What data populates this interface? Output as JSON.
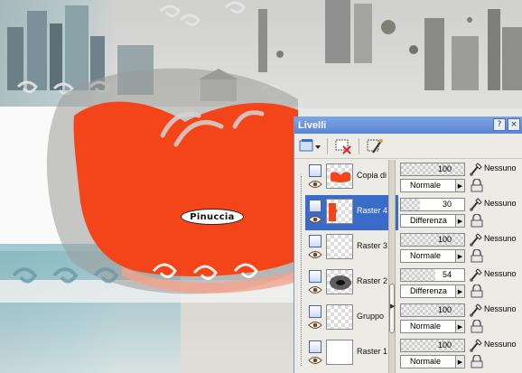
{
  "canvas": {
    "watermark": "Pinuccia"
  },
  "palette": {
    "title": "Livelli",
    "layers": [
      {
        "name": "Copia di",
        "opacity": "100",
        "blend": "Normale",
        "mask": "Nessuno",
        "selected": false,
        "thumb": "red-shape"
      },
      {
        "name": "Raster 4",
        "opacity": "30",
        "blend": "Differenza",
        "mask": "Nessuno",
        "selected": true,
        "thumb": "red-strip"
      },
      {
        "name": "Raster 3",
        "opacity": "100",
        "blend": "Normale",
        "mask": "Nessuno",
        "selected": false,
        "thumb": "empty"
      },
      {
        "name": "Raster 2",
        "opacity": "54",
        "blend": "Differenza",
        "mask": "Nessuno",
        "selected": false,
        "thumb": "dark"
      },
      {
        "name": "Gruppo",
        "opacity": "100",
        "blend": "Normale",
        "mask": "Nessuno",
        "selected": false,
        "thumb": "empty"
      },
      {
        "name": "Raster 1",
        "opacity": "100",
        "blend": "Normale",
        "mask": "Nessuno",
        "selected": false,
        "thumb": "white"
      }
    ]
  },
  "colors": {
    "accent_red": "#f4441a",
    "title_blue": "#5b86d2",
    "selection_blue": "#3b6bc8"
  },
  "icons": [
    "new-layer-icon",
    "delete-layer-icon",
    "properties-icon",
    "eye-icon",
    "paint-brush-icon",
    "lock-icon"
  ]
}
